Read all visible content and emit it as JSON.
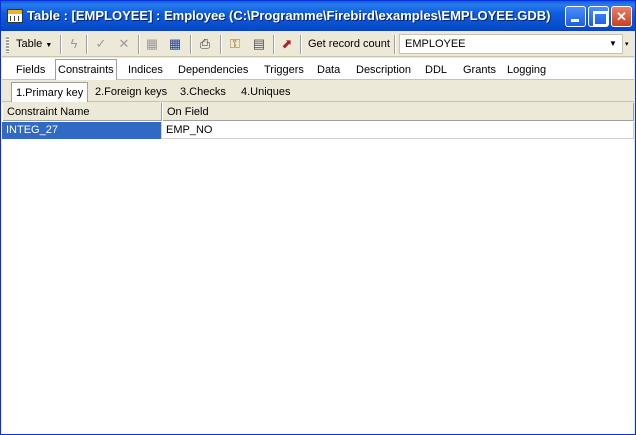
{
  "window": {
    "title": "Table : [EMPLOYEE] : Employee (C:\\Programme\\Firebird\\examples\\EMPLOYEE.GDB)"
  },
  "toolbar": {
    "table_menu_label": "Table",
    "get_record_count_label": "Get record count",
    "table_select_value": "EMPLOYEE"
  },
  "main_tabs": [
    {
      "label": "Fields"
    },
    {
      "label": "Constraints"
    },
    {
      "label": "Indices"
    },
    {
      "label": "Dependencies"
    },
    {
      "label": "Triggers"
    },
    {
      "label": "Data"
    },
    {
      "label": "Description"
    },
    {
      "label": "DDL"
    },
    {
      "label": "Grants"
    },
    {
      "label": "Logging"
    }
  ],
  "constraint_tabs": [
    {
      "label": "1.Primary key"
    },
    {
      "label": "2.Foreign keys"
    },
    {
      "label": "3.Checks"
    },
    {
      "label": "4.Uniques"
    }
  ],
  "grid": {
    "columns": [
      "Constraint Name",
      "On Field"
    ],
    "rows": [
      [
        "INTEG_27",
        "EMP_NO"
      ]
    ]
  }
}
